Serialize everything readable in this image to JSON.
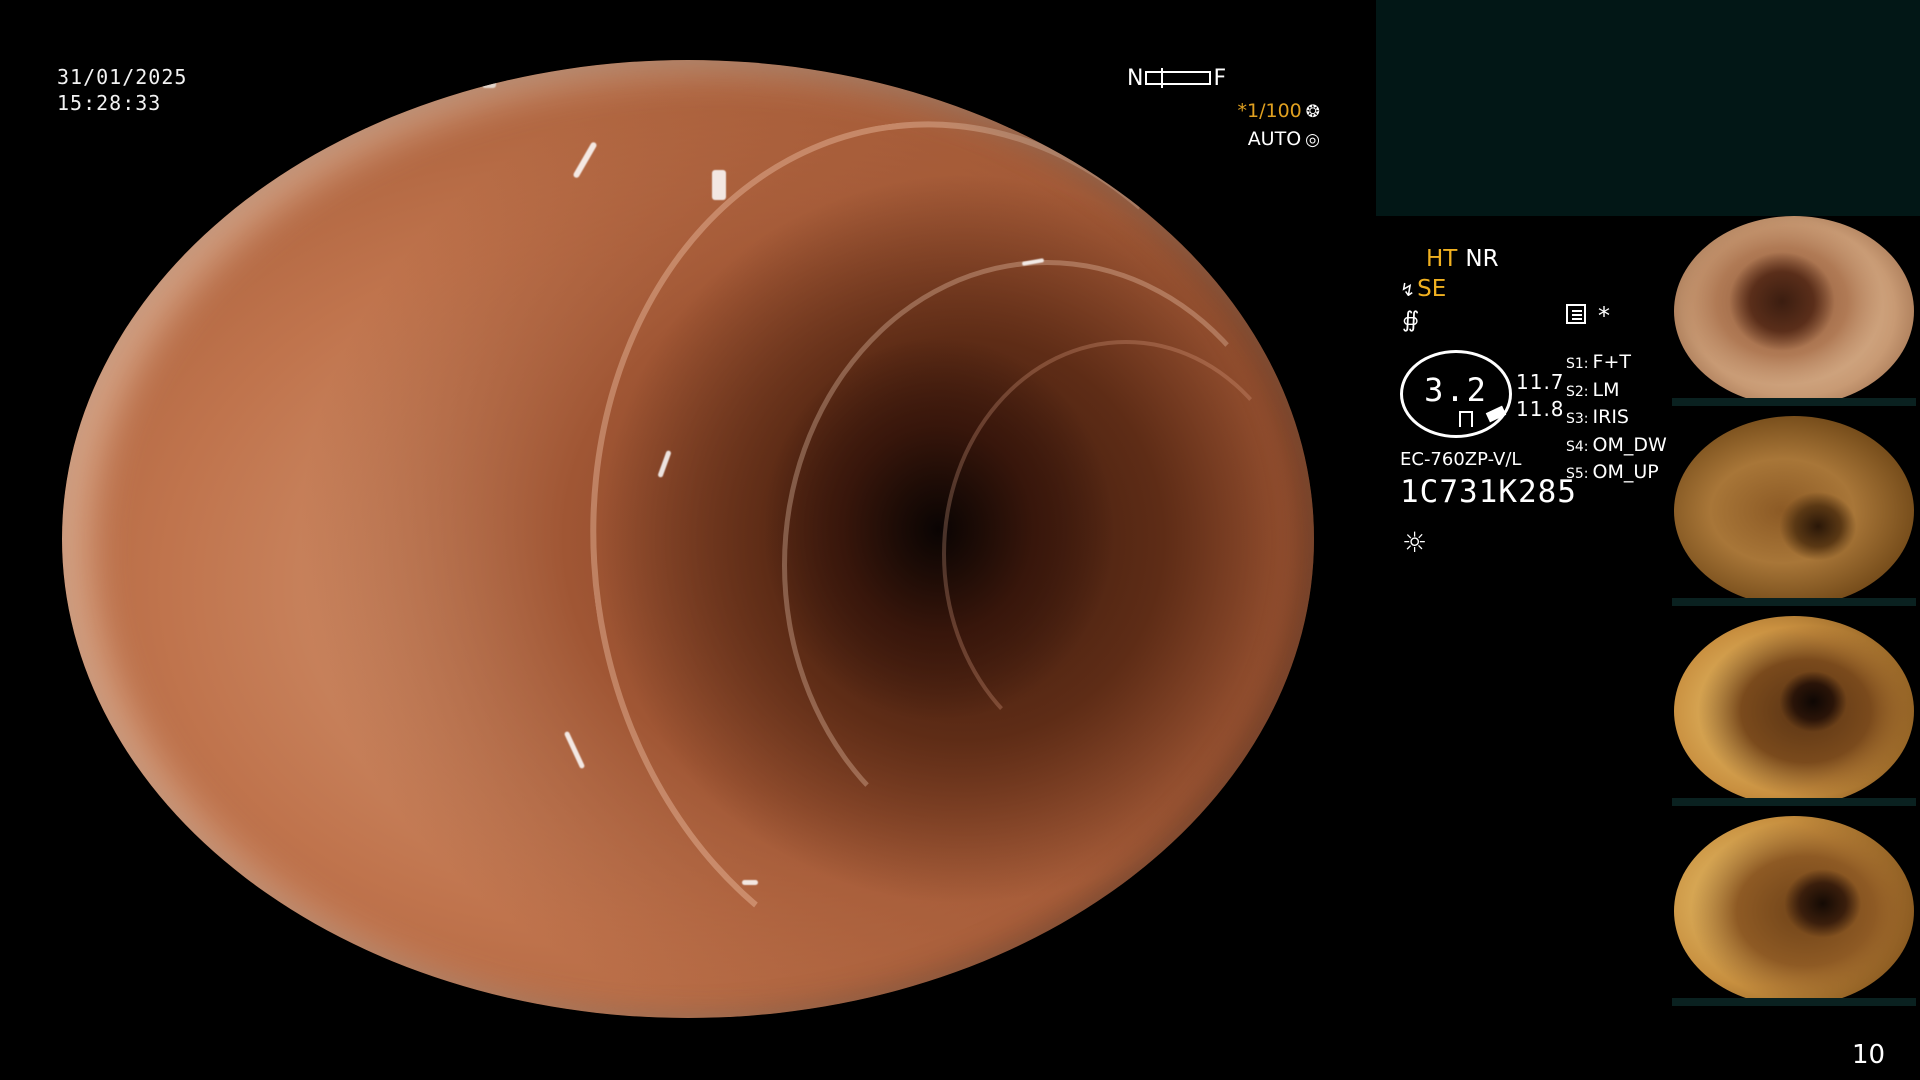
{
  "overlay": {
    "date": "31/01/2025",
    "time": "15:28:33",
    "nf_left": "N",
    "nf_right": "F",
    "shutter": "*1/100",
    "iris_mode": "AUTO"
  },
  "info_panel": {
    "ht": "HT",
    "nr": "NR",
    "se": "SE",
    "gauge_value": "3.2",
    "gauge_side_1": "11.7",
    "gauge_side_2": "11.8",
    "model": "EC-760ZP-V/L",
    "serial": "1C731K285",
    "asterisk": "*",
    "switches": [
      {
        "key": "S1:",
        "value": "F+T"
      },
      {
        "key": "S2:",
        "value": "LM"
      },
      {
        "key": "S3:",
        "value": "IRIS"
      },
      {
        "key": "S4:",
        "value": "OM_DW"
      },
      {
        "key": "S5:",
        "value": "OM_UP"
      }
    ]
  },
  "icons": {
    "shutter": "aperture-icon",
    "iris": "iris-icon",
    "structure": "structure-enhance-icon",
    "curve": "curve-icon",
    "memo": "memo-icon",
    "light": "light-source-icon"
  },
  "colors": {
    "accent_orange": "#f0b020",
    "panel_teal": "#021716"
  },
  "page_number": "10"
}
